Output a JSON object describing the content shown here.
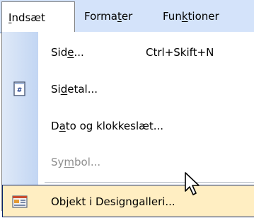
{
  "menubar": {
    "items": [
      {
        "before": "",
        "key": "I",
        "after": "ndsæt"
      },
      {
        "before": "Forma",
        "key": "t",
        "after": "er"
      },
      {
        "before": "Fun",
        "key": "k",
        "after": "tioner"
      }
    ]
  },
  "dropdown": {
    "items": [
      {
        "before": "Sid",
        "key": "e",
        "after": "...",
        "shortcut": "Ctrl+Skift+N",
        "icon": "none",
        "state": "normal"
      },
      {
        "before": "Si",
        "key": "d",
        "after": "etal...",
        "shortcut": "",
        "icon": "page-number-icon",
        "state": "normal"
      },
      {
        "before": "D",
        "key": "a",
        "after": "to og klokkeslæt...",
        "shortcut": "",
        "icon": "none",
        "state": "normal"
      },
      {
        "before": "Sy",
        "key": "m",
        "after": "bol...",
        "shortcut": "",
        "icon": "none",
        "state": "disabled"
      },
      {
        "before": "Ob",
        "key": "j",
        "after": "ekt i Designgalleri...",
        "shortcut": "",
        "icon": "design-gallery-icon",
        "state": "hover"
      }
    ]
  },
  "colors": {
    "menubar_bg": "#d4e3fa",
    "gutter_start": "#dfe9f8",
    "gutter_end": "#c2d6f3",
    "hover_bg": "#ffeec2",
    "hover_border": "#0a246a",
    "disabled_text": "#8d8d8d"
  }
}
